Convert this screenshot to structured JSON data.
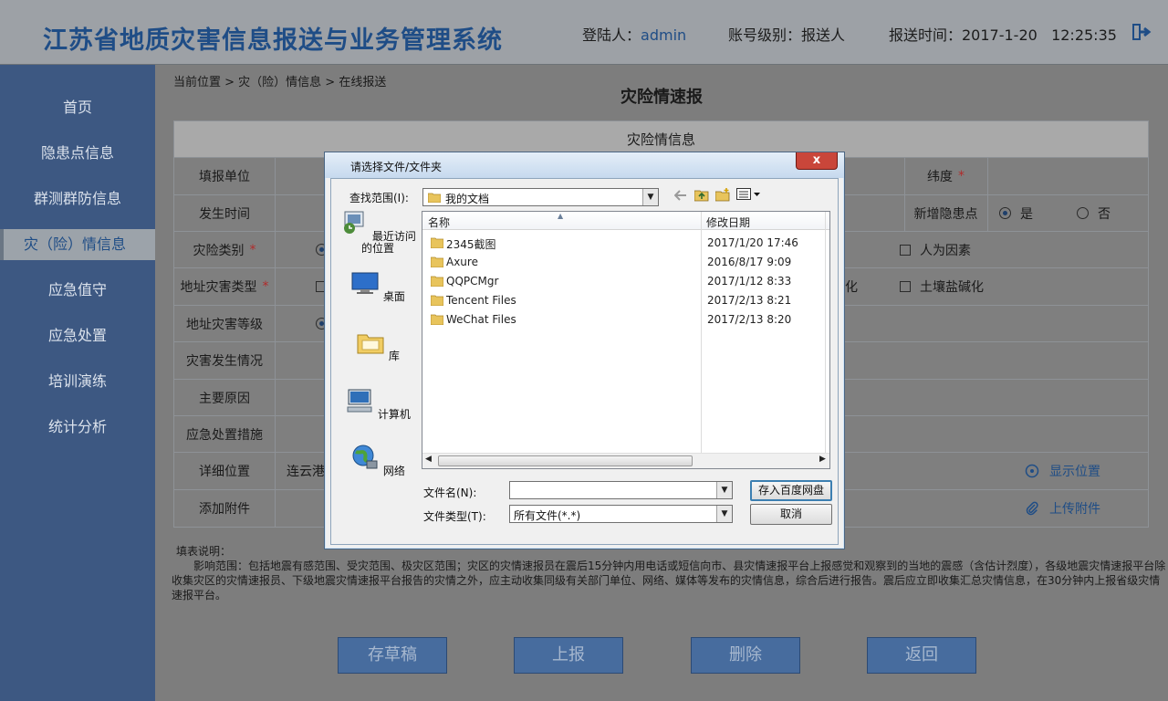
{
  "header": {
    "title": "江苏省地质灾害信息报送与业务管理系统",
    "login_label": "登陆人：",
    "login_user": "admin",
    "level_text": "账号级别：报送人",
    "time_text": "报送时间：2017-1-20   12:25:35"
  },
  "sidebar": {
    "items": [
      "首页",
      "隐患点信息",
      "群测群防信息",
      "灾（险）情信息",
      "应急值守",
      "应急处置",
      "培训演练",
      "统计分析"
    ],
    "active_index": 3
  },
  "breadcrumb": "当前位置 > 灾（险）情信息 > 在线报送",
  "page_title": "灾险情速报",
  "form": {
    "section_title": "灾险情信息",
    "labels": {
      "unit": "填报单位",
      "time": "发生时间",
      "type": "灾险类别",
      "geo_type": "地址灾害类型",
      "level": "地址灾害等级",
      "situation": "灾害发生情况",
      "cause": "主要原因",
      "measures": "应急处置措施",
      "location": "详细位置",
      "attachment": "添加附件"
    },
    "required_mark": "*",
    "latitude_label": "纬度",
    "new_point_label": "新增隐患点",
    "yes": "是",
    "no": "否",
    "human_factor": "人为因素",
    "partial_text": "化",
    "salinization": "土壤盐碱化",
    "location_value": "连云港",
    "show_location": "显示位置",
    "upload": "上传附件"
  },
  "notes": {
    "heading": "填表说明：",
    "body": "影响范围：包括地震有感范围、受灾范围、极灾区范围；灾区的灾情速报员在震后15分钟内用电话或短信向市、县灾情速报平台上报感觉和观察到的当地的震感（含估计烈度），各级地震灾情速报平台除收集灾区的灾情速报员、下级地震灾情速报平台报告的灾情之外，应主动收集同级有关部门单位、网络、媒体等发布的灾情信息，综合后进行报告。震后应立即收集汇总灾情信息，在30分钟内上报省级灾情速报平台。"
  },
  "buttons": {
    "draft": "存草稿",
    "submit": "上报",
    "delete": "删除",
    "back": "返回"
  },
  "dialog": {
    "title": "请选择文件/文件夹",
    "lookin_label": "查找范围(I):",
    "lookin_value": "我的文档",
    "places": [
      "最近访问的位置",
      "桌面",
      "库",
      "计算机",
      "网络"
    ],
    "col_name": "名称",
    "col_date": "修改日期",
    "files": [
      {
        "name": "2345截图",
        "date": "2017/1/20 17:46"
      },
      {
        "name": "Axure",
        "date": "2016/8/17 9:09"
      },
      {
        "name": "QQPCMgr",
        "date": "2017/1/12 8:33"
      },
      {
        "name": "Tencent Files",
        "date": "2017/2/13 8:21"
      },
      {
        "name": "WeChat Files",
        "date": "2017/2/13 8:20"
      }
    ],
    "filename_label": "文件名(N):",
    "filename_value": "",
    "filetype_label": "文件类型(T):",
    "filetype_value": "所有文件(*.*)",
    "save_baidu": "存入百度网盘",
    "cancel": "取消",
    "close": "x"
  }
}
